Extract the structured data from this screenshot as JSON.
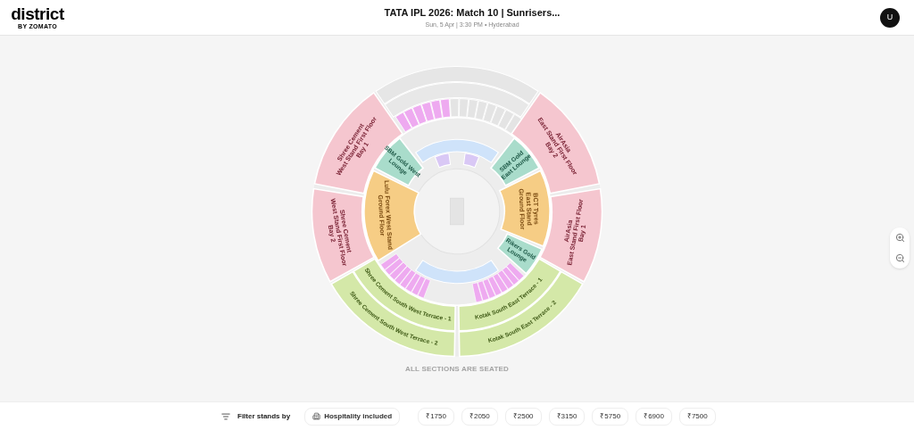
{
  "header": {
    "logo": "district",
    "logo_tagline": "BY ZOMATO",
    "title": "TATA IPL 2026: Match 10 | Sunrisers...",
    "subtitle": "Sun, 5 Apr | 3:30 PM • Hyderabad",
    "avatar": "U"
  },
  "sections": [
    {
      "lines": [
        "Shree Cement",
        "West Stand First Floor",
        "Bay 1"
      ],
      "color": "#f5c6cf"
    },
    {
      "lines": [
        "Shree Cement",
        "West Stand First Floor",
        "Bay 2"
      ],
      "color": "#f5c6cf"
    },
    {
      "lines": [
        "Lulu Forex West Stand",
        "Ground Floor"
      ],
      "color": "#f6cd85"
    },
    {
      "lines": [
        "SBM Gold West",
        "Lounge"
      ],
      "color": "#a9dccb"
    },
    {
      "lines": [
        "SBM Gold",
        "East Lounge"
      ],
      "color": "#a9dccb"
    },
    {
      "lines": [
        "BCT Tyres",
        "East Stand",
        "Ground Floor"
      ],
      "color": "#f6cd85"
    },
    {
      "lines": [
        "Rikers Gold",
        "Lounge"
      ],
      "color": "#a9dccb"
    },
    {
      "lines": [
        "AirAsia",
        "East Stand First Floor",
        "Bay 2"
      ],
      "color": "#f5c6cf"
    },
    {
      "lines": [
        "AirAsia",
        "East Stand First Floor",
        "Bay 1"
      ],
      "color": "#f5c6cf"
    },
    {
      "lines": [
        "Shree Cement South West Terrace - 1"
      ],
      "color": "#d4e8a8"
    },
    {
      "lines": [
        "Shree Cement South West Terrace - 2"
      ],
      "color": "#d4e8a8"
    },
    {
      "lines": [
        "Kotak South East Terrace - 1"
      ],
      "color": "#d4e8a8"
    },
    {
      "lines": [
        "Kotak South East Terrace - 2"
      ],
      "color": "#d4e8a8"
    }
  ],
  "seating_note": "ALL SECTIONS ARE SEATED",
  "filter": {
    "label": "Filter stands by",
    "chips": [
      {
        "label": "Hospitality included",
        "kind": "hospitality"
      },
      {
        "label": "₹1750",
        "kind": "price"
      },
      {
        "label": "₹2050",
        "kind": "price"
      },
      {
        "label": "₹2500",
        "kind": "price"
      },
      {
        "label": "₹3150",
        "kind": "price"
      },
      {
        "label": "₹5750",
        "kind": "price"
      },
      {
        "label": "₹6900",
        "kind": "price"
      },
      {
        "label": "₹7500",
        "kind": "price"
      }
    ]
  }
}
